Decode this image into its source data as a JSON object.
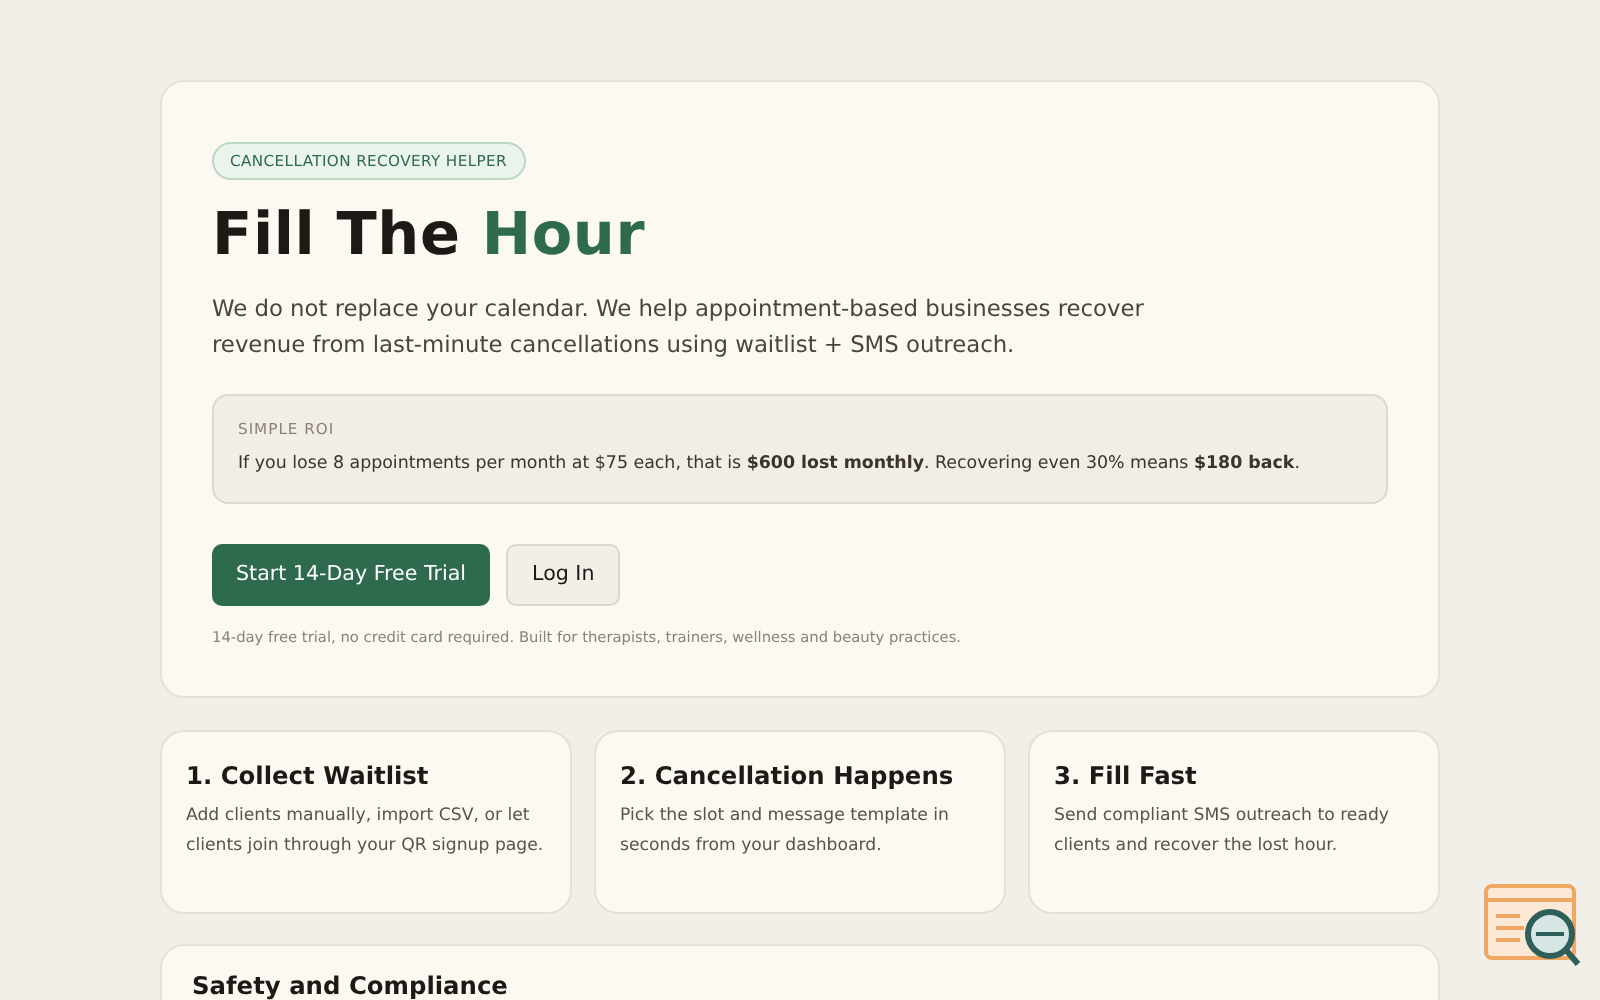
{
  "hero": {
    "badge": "CANCELLATION RECOVERY HELPER",
    "title": "Fill The",
    "title_accent": "Hour",
    "intro": "We do not replace your calendar. We help appointment-based businesses recover revenue from last-minute cancellations using waitlist + SMS outreach.",
    "roi": {
      "label": "SIMPLE ROI",
      "text": "If you lose 8 appointments per month at $75 each, that is **$600 lost monthly**. Recovering even 30% means **$180 back**."
    },
    "buttons": [
      {
        "label": "Start 14-Day Free Trial",
        "kind": "primary"
      },
      {
        "label": "Log In",
        "kind": "secondary"
      }
    ],
    "note": "14-day free trial, no credit card required. Built for therapists, trainers, wellness and beauty practices."
  },
  "steps": [
    {
      "title": "1. Collect Waitlist",
      "text": "Add clients manually, import CSV, or let clients join through your QR signup page."
    },
    {
      "title": "2. Cancellation Happens",
      "text": "Pick the slot and message template in seconds from your dashboard."
    },
    {
      "title": "3. Fill Fast",
      "text": "Send compliant SMS outreach to ready clients and recover the lost hour."
    }
  ],
  "safety": {
    "title": "Safety and Compliance"
  }
}
